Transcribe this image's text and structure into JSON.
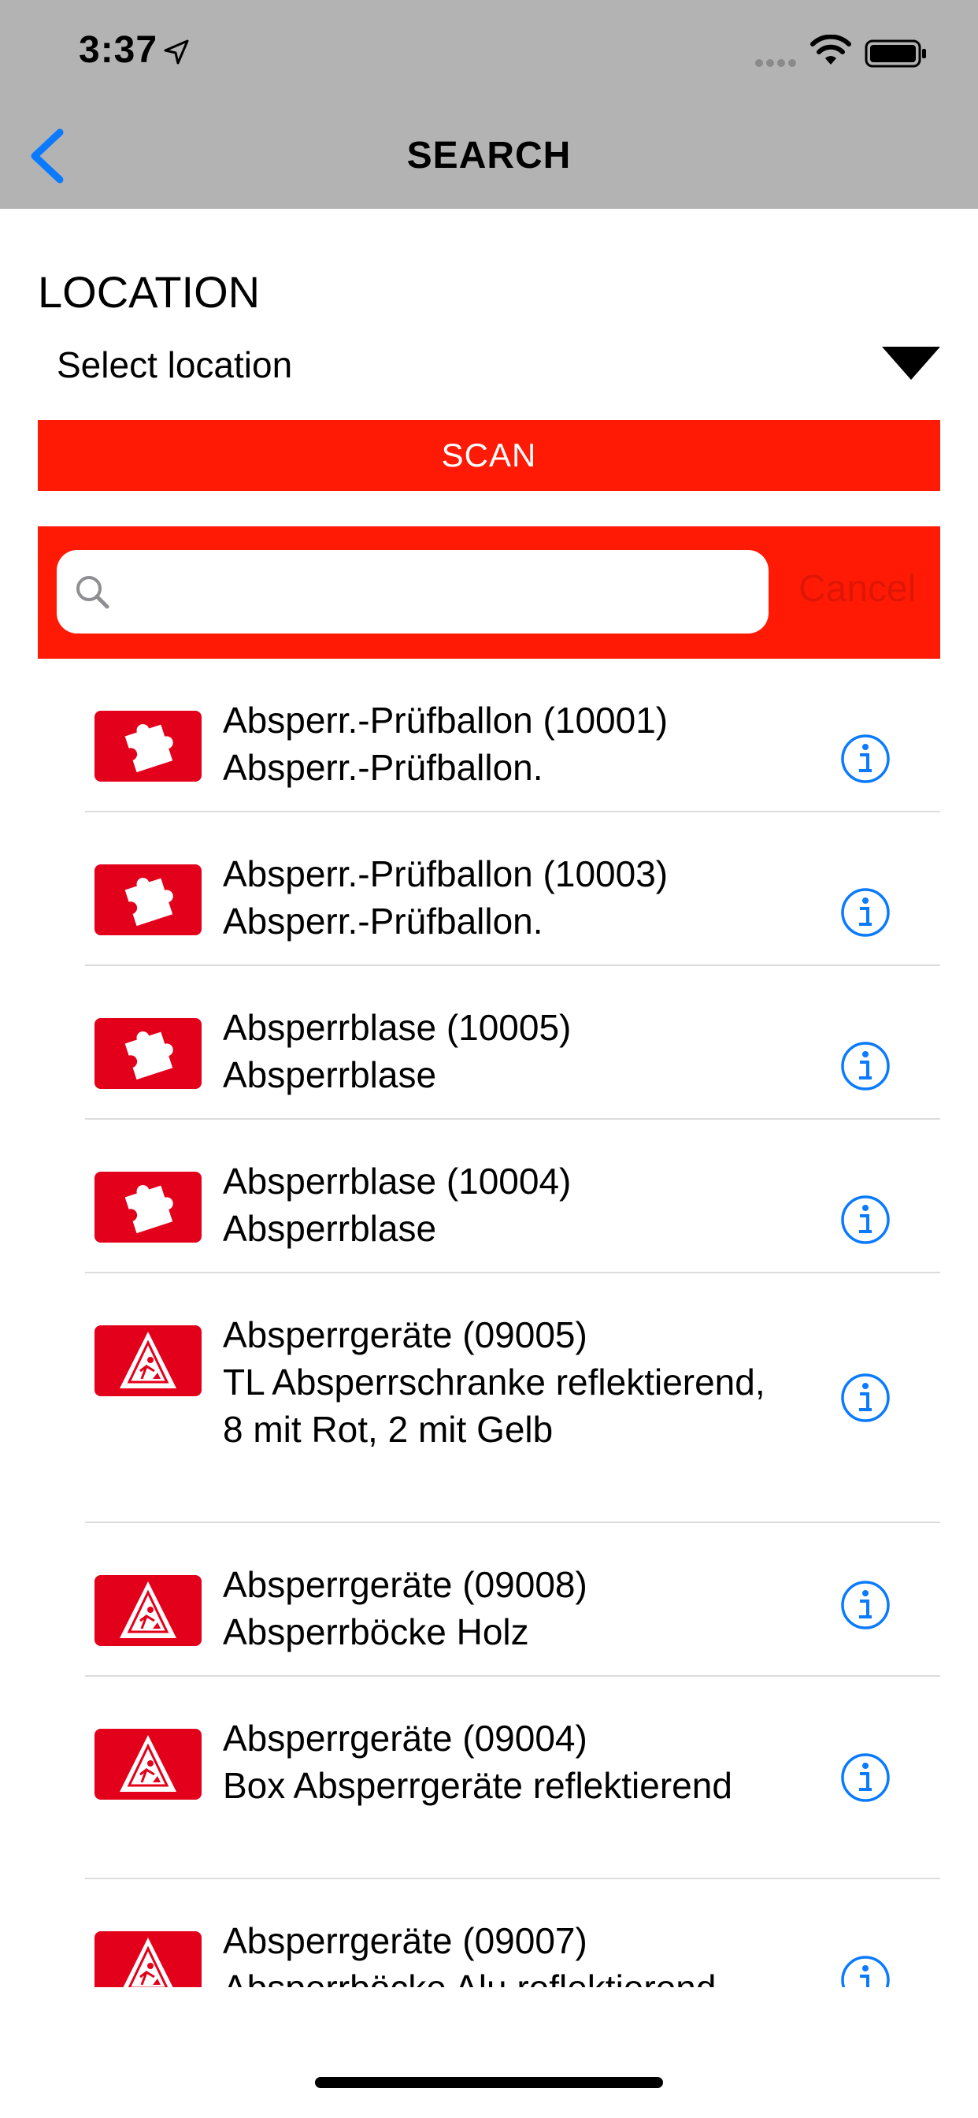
{
  "status_bar": {
    "time": "3:37"
  },
  "nav": {
    "title": "SEARCH"
  },
  "location": {
    "label": "LOCATION",
    "selected": "Select location"
  },
  "scan_label": "SCAN",
  "search": {
    "placeholder": "",
    "cancel_label": "Cancel"
  },
  "items": [
    {
      "icon": "puzzle-icon",
      "title": "Absperr.-Prüfballon (10001)",
      "subtitle": "Absperr.-Prüfballon."
    },
    {
      "icon": "puzzle-icon",
      "title": "Absperr.-Prüfballon (10003)",
      "subtitle": "Absperr.-Prüfballon."
    },
    {
      "icon": "puzzle-icon",
      "title": "Absperrblase (10005)",
      "subtitle": "Absperrblase"
    },
    {
      "icon": "puzzle-icon",
      "title": "Absperrblase (10004)",
      "subtitle": "Absperrblase"
    },
    {
      "icon": "roadwork-sign-icon",
      "title": "Absperrgeräte (09005)",
      "subtitle": "TL Absperrschranke reflektierend, 8 mit Rot, 2 mit Gelb"
    },
    {
      "icon": "roadwork-sign-icon",
      "title": "Absperrgeräte (09008)",
      "subtitle": "Absperrböcke Holz"
    },
    {
      "icon": "roadwork-sign-icon",
      "title": "Absperrgeräte (09004)",
      "subtitle": "Box Absperrgeräte reflektierend"
    },
    {
      "icon": "roadwork-sign-icon",
      "title": "Absperrgeräte (09007)",
      "subtitle": "Absperrböcke Alu reflektierend"
    }
  ],
  "colors": {
    "accent_red": "#ff1a06",
    "icon_red": "#e3001b",
    "link_blue": "#0a7aff",
    "nav_gray": "#b3b3b3"
  }
}
